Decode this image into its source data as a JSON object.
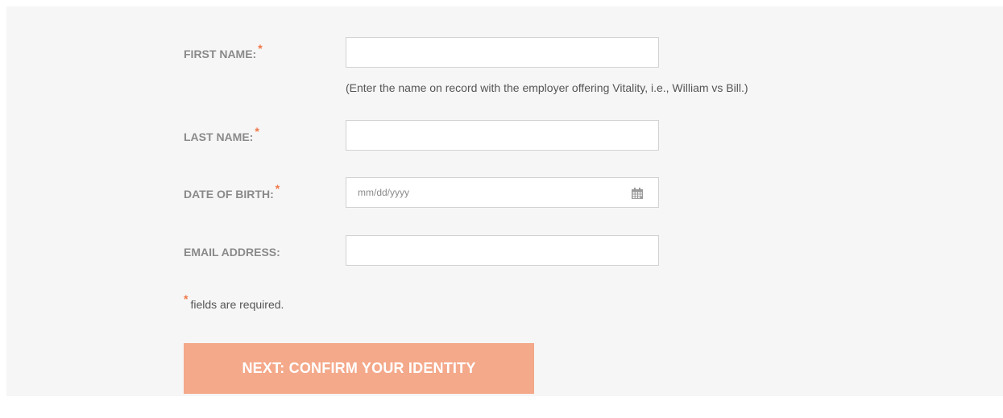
{
  "form": {
    "first_name": {
      "label": "FIRST NAME:",
      "required_mark": "*",
      "value": "",
      "hint": "(Enter the name on record with the employer offering Vitality, i.e., William vs Bill.)"
    },
    "last_name": {
      "label": "LAST NAME:",
      "required_mark": "*",
      "value": ""
    },
    "date_of_birth": {
      "label": "DATE OF BIRTH:",
      "required_mark": "*",
      "placeholder": "mm/dd/yyyy",
      "icon": "calendar-icon"
    },
    "email": {
      "label": "EMAIL ADDRESS:",
      "value": ""
    },
    "required_note": {
      "mark": "*",
      "text": "fields are required."
    },
    "submit_label": "NEXT: CONFIRM YOUR IDENTITY"
  },
  "colors": {
    "background": "#f6f6f6",
    "label": "#8a8a8a",
    "required": "#f0784a",
    "button": "#f4a98a",
    "button_text": "#ffffff"
  }
}
